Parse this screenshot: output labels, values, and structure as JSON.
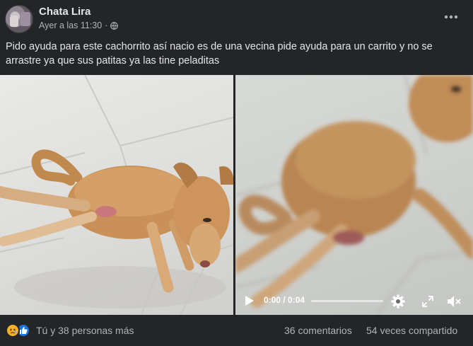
{
  "post": {
    "author": "Chata Lira",
    "timestamp": "Ayer a las 11:30",
    "separator": "·",
    "privacy_icon": "globe-icon",
    "caption": "Pido ayuda para este cachorrito así nacio es de una vecina pide ayuda para un carrito y no se arrastre ya que sus patitas ya las tine peladitas"
  },
  "video": {
    "time_display": "0:00 / 0:04",
    "progress": 0,
    "icons": [
      "play-icon",
      "settings-icon",
      "fullscreen-icon",
      "volume-muted-icon"
    ]
  },
  "footer": {
    "reactions_text": "Tú y 38 personas más",
    "reaction_icons": [
      "sad-icon",
      "like-icon"
    ],
    "comments_text": "36 comentarios",
    "shares_text": "54 veces compartido"
  },
  "colors": {
    "background": "#242526",
    "primary_text": "#e4e6eb",
    "secondary_text": "#b0b3b8",
    "like_blue": "#1b74e4",
    "sad_yellow": "#f7b125"
  }
}
